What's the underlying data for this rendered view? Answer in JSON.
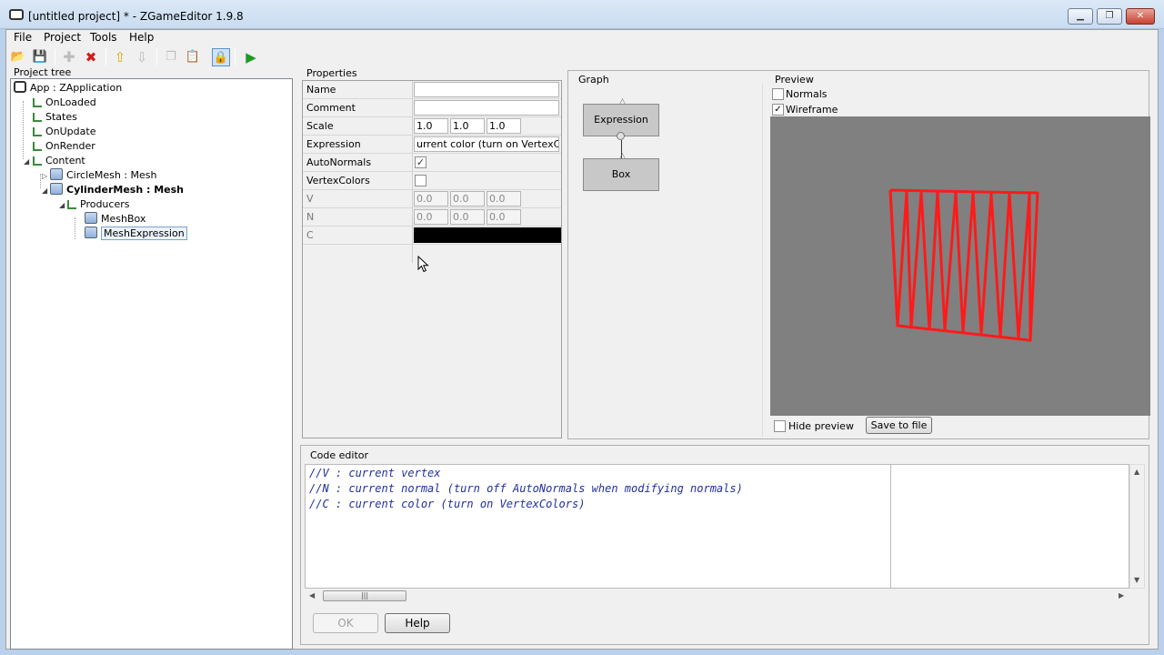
{
  "window": {
    "title": "[untitled project] * - ZGameEditor 1.9.8"
  },
  "menu": [
    "File",
    "Project",
    "Tools",
    "Help"
  ],
  "tree": {
    "title": "Project tree",
    "nodes": [
      {
        "label": "App : ZApplication"
      },
      {
        "label": "OnLoaded"
      },
      {
        "label": "States"
      },
      {
        "label": "OnUpdate"
      },
      {
        "label": "OnRender"
      },
      {
        "label": "Content"
      },
      {
        "label": "CircleMesh : Mesh"
      },
      {
        "label": "CylinderMesh : Mesh"
      },
      {
        "label": "Producers"
      },
      {
        "label": "MeshBox"
      },
      {
        "label": "MeshExpression"
      }
    ]
  },
  "properties": {
    "title": "Properties",
    "name_label": "Name",
    "name_value": "",
    "comment_label": "Comment",
    "comment_value": "",
    "scale_label": "Scale",
    "scale_x": "1.0",
    "scale_y": "1.0",
    "scale_z": "1.0",
    "expression_label": "Expression",
    "expression_value": "urrent color (turn on VertexColors)",
    "autonormals_label": "AutoNormals",
    "autonormals_checked": true,
    "vertexcolors_label": "VertexColors",
    "vertexcolors_checked": false,
    "v_label": "V",
    "v_x": "0.0",
    "v_y": "0.0",
    "v_z": "0.0",
    "n_label": "N",
    "n_x": "0.0",
    "n_y": "0.0",
    "n_z": "0.0",
    "c_label": "C",
    "c_color": "#000000"
  },
  "graph": {
    "title": "Graph",
    "nodes": [
      "Expression",
      "Box"
    ]
  },
  "preview": {
    "title": "Preview",
    "normals_label": "Normals",
    "normals_checked": false,
    "wireframe_label": "Wireframe",
    "wireframe_checked": true,
    "hide_label": "Hide preview",
    "hide_checked": false,
    "save_label": "Save to file",
    "background_color": "#808080",
    "wire_color": "#ff1a1a"
  },
  "code": {
    "title": "Code editor",
    "lines": [
      "//V : current vertex",
      "//N : current normal (turn off AutoNormals when modifying normals)",
      "//C : current color (turn on VertexColors)"
    ],
    "ok_label": "OK",
    "help_label": "Help"
  }
}
